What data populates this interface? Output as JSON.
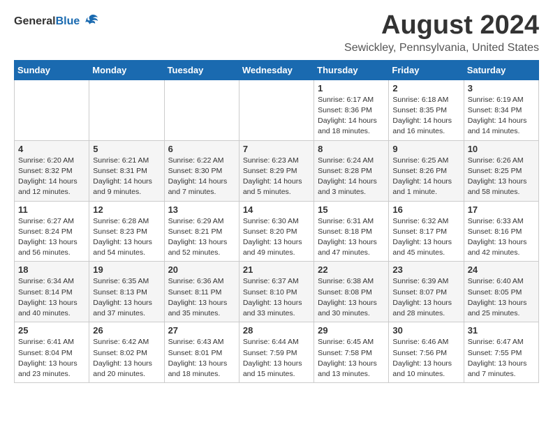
{
  "header": {
    "logo_general": "General",
    "logo_blue": "Blue",
    "title": "August 2024",
    "subtitle": "Sewickley, Pennsylvania, United States"
  },
  "days_of_week": [
    "Sunday",
    "Monday",
    "Tuesday",
    "Wednesday",
    "Thursday",
    "Friday",
    "Saturday"
  ],
  "weeks": [
    [
      {
        "day": "",
        "info": ""
      },
      {
        "day": "",
        "info": ""
      },
      {
        "day": "",
        "info": ""
      },
      {
        "day": "",
        "info": ""
      },
      {
        "day": "1",
        "info": "Sunrise: 6:17 AM\nSunset: 8:36 PM\nDaylight: 14 hours\nand 18 minutes."
      },
      {
        "day": "2",
        "info": "Sunrise: 6:18 AM\nSunset: 8:35 PM\nDaylight: 14 hours\nand 16 minutes."
      },
      {
        "day": "3",
        "info": "Sunrise: 6:19 AM\nSunset: 8:34 PM\nDaylight: 14 hours\nand 14 minutes."
      }
    ],
    [
      {
        "day": "4",
        "info": "Sunrise: 6:20 AM\nSunset: 8:32 PM\nDaylight: 14 hours\nand 12 minutes."
      },
      {
        "day": "5",
        "info": "Sunrise: 6:21 AM\nSunset: 8:31 PM\nDaylight: 14 hours\nand 9 minutes."
      },
      {
        "day": "6",
        "info": "Sunrise: 6:22 AM\nSunset: 8:30 PM\nDaylight: 14 hours\nand 7 minutes."
      },
      {
        "day": "7",
        "info": "Sunrise: 6:23 AM\nSunset: 8:29 PM\nDaylight: 14 hours\nand 5 minutes."
      },
      {
        "day": "8",
        "info": "Sunrise: 6:24 AM\nSunset: 8:28 PM\nDaylight: 14 hours\nand 3 minutes."
      },
      {
        "day": "9",
        "info": "Sunrise: 6:25 AM\nSunset: 8:26 PM\nDaylight: 14 hours\nand 1 minute."
      },
      {
        "day": "10",
        "info": "Sunrise: 6:26 AM\nSunset: 8:25 PM\nDaylight: 13 hours\nand 58 minutes."
      }
    ],
    [
      {
        "day": "11",
        "info": "Sunrise: 6:27 AM\nSunset: 8:24 PM\nDaylight: 13 hours\nand 56 minutes."
      },
      {
        "day": "12",
        "info": "Sunrise: 6:28 AM\nSunset: 8:23 PM\nDaylight: 13 hours\nand 54 minutes."
      },
      {
        "day": "13",
        "info": "Sunrise: 6:29 AM\nSunset: 8:21 PM\nDaylight: 13 hours\nand 52 minutes."
      },
      {
        "day": "14",
        "info": "Sunrise: 6:30 AM\nSunset: 8:20 PM\nDaylight: 13 hours\nand 49 minutes."
      },
      {
        "day": "15",
        "info": "Sunrise: 6:31 AM\nSunset: 8:18 PM\nDaylight: 13 hours\nand 47 minutes."
      },
      {
        "day": "16",
        "info": "Sunrise: 6:32 AM\nSunset: 8:17 PM\nDaylight: 13 hours\nand 45 minutes."
      },
      {
        "day": "17",
        "info": "Sunrise: 6:33 AM\nSunset: 8:16 PM\nDaylight: 13 hours\nand 42 minutes."
      }
    ],
    [
      {
        "day": "18",
        "info": "Sunrise: 6:34 AM\nSunset: 8:14 PM\nDaylight: 13 hours\nand 40 minutes."
      },
      {
        "day": "19",
        "info": "Sunrise: 6:35 AM\nSunset: 8:13 PM\nDaylight: 13 hours\nand 37 minutes."
      },
      {
        "day": "20",
        "info": "Sunrise: 6:36 AM\nSunset: 8:11 PM\nDaylight: 13 hours\nand 35 minutes."
      },
      {
        "day": "21",
        "info": "Sunrise: 6:37 AM\nSunset: 8:10 PM\nDaylight: 13 hours\nand 33 minutes."
      },
      {
        "day": "22",
        "info": "Sunrise: 6:38 AM\nSunset: 8:08 PM\nDaylight: 13 hours\nand 30 minutes."
      },
      {
        "day": "23",
        "info": "Sunrise: 6:39 AM\nSunset: 8:07 PM\nDaylight: 13 hours\nand 28 minutes."
      },
      {
        "day": "24",
        "info": "Sunrise: 6:40 AM\nSunset: 8:05 PM\nDaylight: 13 hours\nand 25 minutes."
      }
    ],
    [
      {
        "day": "25",
        "info": "Sunrise: 6:41 AM\nSunset: 8:04 PM\nDaylight: 13 hours\nand 23 minutes."
      },
      {
        "day": "26",
        "info": "Sunrise: 6:42 AM\nSunset: 8:02 PM\nDaylight: 13 hours\nand 20 minutes."
      },
      {
        "day": "27",
        "info": "Sunrise: 6:43 AM\nSunset: 8:01 PM\nDaylight: 13 hours\nand 18 minutes."
      },
      {
        "day": "28",
        "info": "Sunrise: 6:44 AM\nSunset: 7:59 PM\nDaylight: 13 hours\nand 15 minutes."
      },
      {
        "day": "29",
        "info": "Sunrise: 6:45 AM\nSunset: 7:58 PM\nDaylight: 13 hours\nand 13 minutes."
      },
      {
        "day": "30",
        "info": "Sunrise: 6:46 AM\nSunset: 7:56 PM\nDaylight: 13 hours\nand 10 minutes."
      },
      {
        "day": "31",
        "info": "Sunrise: 6:47 AM\nSunset: 7:55 PM\nDaylight: 13 hours\nand 7 minutes."
      }
    ]
  ]
}
